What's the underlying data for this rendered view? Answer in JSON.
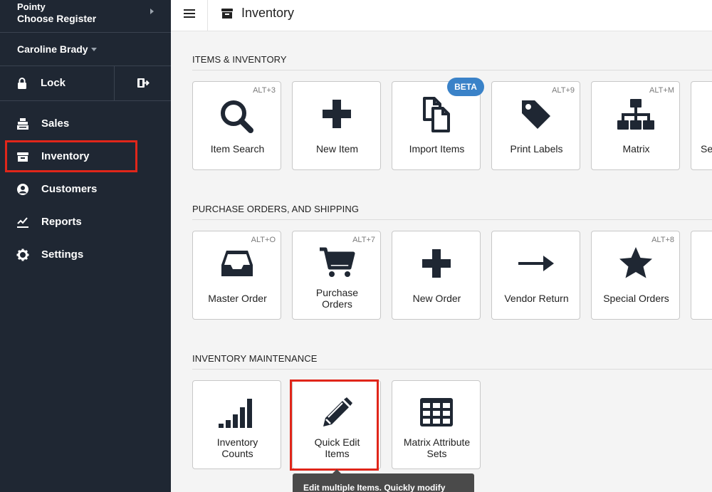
{
  "sidebar": {
    "store_name": "Pointy",
    "register": "Choose Register",
    "user": "Caroline Brady",
    "lock_label": "Lock",
    "items": [
      {
        "label": "Sales",
        "icon": "register-icon"
      },
      {
        "label": "Inventory",
        "icon": "inventory-box-icon"
      },
      {
        "label": "Customers",
        "icon": "user-circle-icon"
      },
      {
        "label": "Reports",
        "icon": "line-chart-icon"
      },
      {
        "label": "Settings",
        "icon": "gear-icon"
      }
    ],
    "active_item": "Inventory"
  },
  "header": {
    "title": "Inventory"
  },
  "sections": [
    {
      "title": "ITEMS & INVENTORY",
      "tiles": [
        {
          "label": "Item Search",
          "shortcut": "ALT+3",
          "icon": "search-icon"
        },
        {
          "label": "New Item",
          "shortcut": "",
          "icon": "plus-icon"
        },
        {
          "label": "Import Items",
          "shortcut": "",
          "icon": "copy-documents-icon",
          "badge": "BETA"
        },
        {
          "label": "Print Labels",
          "shortcut": "ALT+9",
          "icon": "tag-icon"
        },
        {
          "label": "Matrix",
          "shortcut": "ALT+M",
          "icon": "sitemap-icon"
        },
        {
          "label": "Se",
          "shortcut": "",
          "icon": ""
        }
      ]
    },
    {
      "title": "PURCHASE ORDERS, AND SHIPPING",
      "tiles": [
        {
          "label": "Master Order",
          "shortcut": "ALT+O",
          "icon": "inbox-tray-icon"
        },
        {
          "label": "Purchase Orders",
          "line1": "Purchase",
          "line2": "Orders",
          "shortcut": "ALT+7",
          "icon": "shopping-cart-icon"
        },
        {
          "label": "New Order",
          "shortcut": "",
          "icon": "plus-icon"
        },
        {
          "label": "Vendor Return",
          "shortcut": "",
          "icon": "arrow-right-icon"
        },
        {
          "label": "Special Orders",
          "shortcut": "ALT+8",
          "icon": "star-icon"
        }
      ]
    },
    {
      "title": "INVENTORY MAINTENANCE",
      "tiles": [
        {
          "label": "Inventory Counts",
          "line1": "Inventory",
          "line2": "Counts",
          "shortcut": "",
          "icon": "signal-bars-icon"
        },
        {
          "label": "Quick Edit Items",
          "line1": "Quick Edit",
          "line2": "Items",
          "shortcut": "",
          "icon": "pencil-icon"
        },
        {
          "label": "Matrix Attribute Sets",
          "line1": "Matrix Attribute",
          "line2": "Sets",
          "shortcut": "",
          "icon": "table-grid-icon"
        }
      ]
    }
  ],
  "tooltip": "Edit multiple Items. Quickly modify",
  "colors": {
    "sidebar_bg": "#1f2733",
    "highlight": "#e0261a",
    "beta_badge": "#3a82c8",
    "icon": "#1f2733"
  }
}
